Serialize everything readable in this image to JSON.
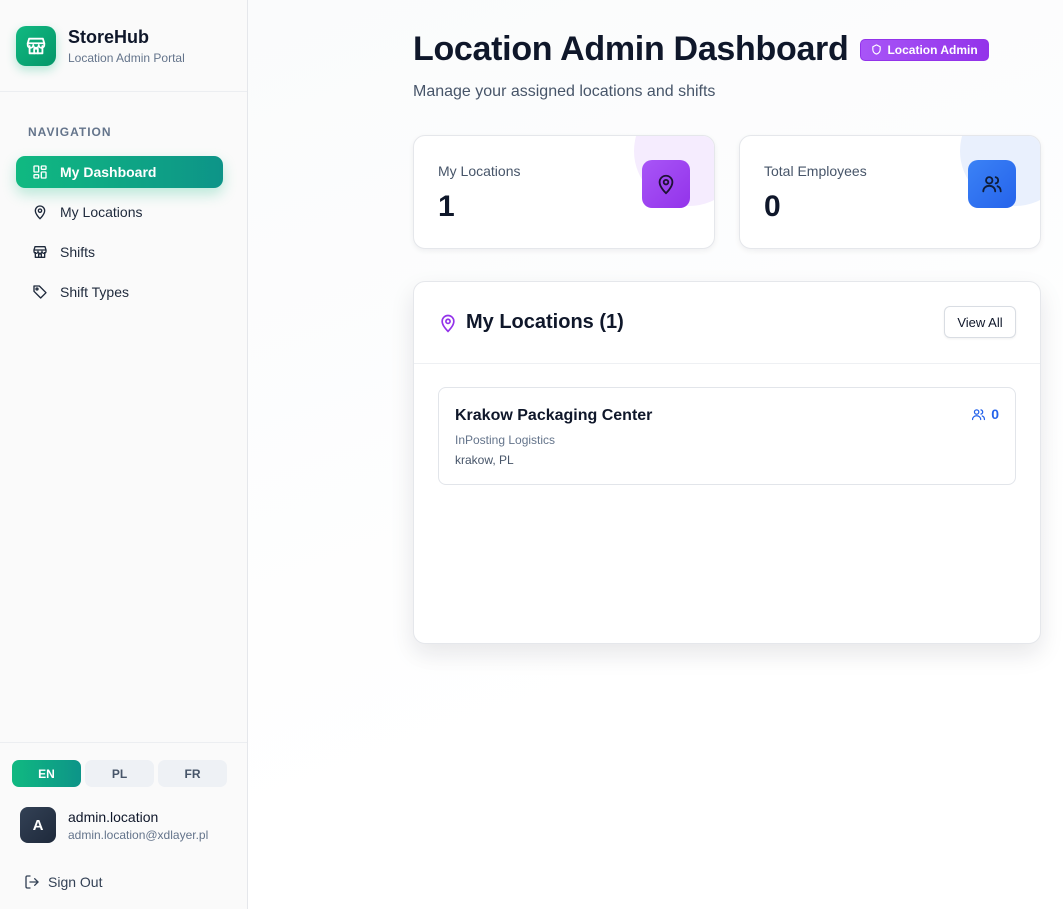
{
  "brand": {
    "name": "StoreHub",
    "subtitle": "Location Admin Portal",
    "icon": "store-icon"
  },
  "navigation": {
    "title": "NAVIGATION",
    "items": [
      {
        "label": "My Dashboard",
        "icon": "dashboard-icon",
        "active": true
      },
      {
        "label": "My Locations",
        "icon": "map-pin-icon",
        "active": false
      },
      {
        "label": "Shifts",
        "icon": "store-icon",
        "active": false
      },
      {
        "label": "Shift Types",
        "icon": "tag-icon",
        "active": false
      }
    ]
  },
  "languages": [
    {
      "code": "EN",
      "active": true
    },
    {
      "code": "PL",
      "active": false
    },
    {
      "code": "FR",
      "active": false
    }
  ],
  "user": {
    "initial": "A",
    "name": "admin.location",
    "email": "admin.location@xdlayer.pl"
  },
  "sign_out": "Sign Out",
  "header": {
    "title": "Location Admin Dashboard",
    "badge": "Location Admin",
    "subtitle": "Manage your assigned locations and shifts"
  },
  "stats": [
    {
      "label": "My Locations",
      "value": "1",
      "icon": "map-pin-icon",
      "color": "#a855f7"
    },
    {
      "label": "Total Employees",
      "value": "0",
      "icon": "users-icon",
      "color": "#3b82f6"
    }
  ],
  "locations_panel": {
    "title": "My Locations (1)",
    "view_all": "View All",
    "items": [
      {
        "name": "Krakow Packaging Center",
        "company": "InPosting Logistics",
        "city": "krakow, PL",
        "employees": "0"
      }
    ]
  },
  "colors": {
    "accent": "#10b981",
    "purple": "#a855f7",
    "blue": "#2563eb"
  }
}
